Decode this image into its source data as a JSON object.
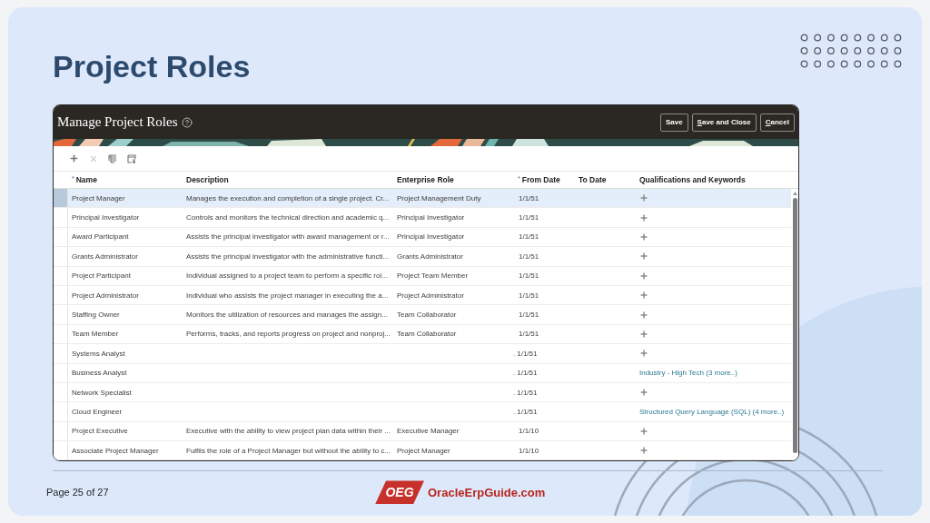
{
  "slide": {
    "title": "Project Roles"
  },
  "window": {
    "title": "Manage Project Roles",
    "buttons": [
      {
        "label": "Save",
        "mnemonic": false
      },
      {
        "label": "Save and Close",
        "mnemonic": true
      },
      {
        "label": "Cancel",
        "mnemonic": true
      }
    ]
  },
  "toolbar": [
    {
      "kind": "add",
      "disabled": false
    },
    {
      "kind": "delete",
      "disabled": true
    },
    {
      "kind": "freeze",
      "disabled": false
    },
    {
      "kind": "detach",
      "disabled": false
    }
  ],
  "table": {
    "columns": [
      {
        "label": "Name",
        "mark": "*"
      },
      {
        "label": "Description"
      },
      {
        "label": "Enterprise Role"
      },
      {
        "label": "From Date",
        "mark": "*"
      },
      {
        "label": "To Date"
      },
      {
        "label": "Qualifications and Keywords"
      }
    ],
    "rows": [
      {
        "name": "Project Manager",
        "description": "Manages the execution and completion of a single project. Cr...",
        "enterprise_role": "Project Management Duty",
        "from_date": "1/1/51",
        "qualifications": {
          "kind": "add"
        },
        "selected": true
      },
      {
        "name": "Principal Investigator",
        "description": "Controls and monitors the technical direction and academic q...",
        "enterprise_role": "Principal Investigator",
        "from_date": "1/1/51",
        "qualifications": {
          "kind": "add"
        },
        "selected": false
      },
      {
        "name": "Award Participant",
        "description": "Assists the principal investigator with award management or r...",
        "enterprise_role": "Principal Investigator",
        "from_date": "1/1/51",
        "qualifications": {
          "kind": "add"
        },
        "selected": false
      },
      {
        "name": "Grants Administrator",
        "description": "Assists the principal investigator with the administrative functi...",
        "enterprise_role": "Grants Administrator",
        "from_date": "1/1/51",
        "qualifications": {
          "kind": "add"
        },
        "selected": false
      },
      {
        "name": "Project Participant",
        "description": "Individual assigned to a project team to perform a specific rol...",
        "enterprise_role": "Project Team Member",
        "from_date": "1/1/51",
        "qualifications": {
          "kind": "add"
        },
        "selected": false
      },
      {
        "name": "Project Administrator",
        "description": "Individual who assists the project manager in executing the a...",
        "enterprise_role": "Project Administrator",
        "from_date": "1/1/51",
        "qualifications": {
          "kind": "add"
        },
        "selected": false
      },
      {
        "name": "Staffing Owner",
        "description": "Monitors the utilization of resources and manages the assign...",
        "enterprise_role": "Team Collaborator",
        "from_date": "1/1/51",
        "qualifications": {
          "kind": "add"
        },
        "selected": false
      },
      {
        "name": "Team Member",
        "description": "Performs, tracks, and reports progress on project and nonproj...",
        "enterprise_role": "Team Collaborator",
        "from_date": "1/1/51",
        "qualifications": {
          "kind": "add"
        },
        "selected": false
      },
      {
        "name": "Systems Analyst",
        "date_mark": ".",
        "from_date": "1/1/51",
        "qualifications": {
          "kind": "add"
        },
        "selected": false
      },
      {
        "name": "Business Analyst",
        "date_mark": ".",
        "from_date": "1/1/51",
        "qualifications": {
          "kind": "link",
          "text": "Industry - High Tech (3 more..)"
        },
        "selected": false
      },
      {
        "name": "Network Specialist",
        "date_mark": ".",
        "from_date": "1/1/51",
        "qualifications": {
          "kind": "add"
        },
        "selected": false
      },
      {
        "name": "Cloud Engineer",
        "date_mark": ".",
        "from_date": "1/1/51",
        "qualifications": {
          "kind": "link",
          "text": "Structured Query Language (SQL) (4 more..)"
        },
        "selected": false
      },
      {
        "name": "Project Executive",
        "description": "Executive with the ability to view project plan data within their ...",
        "enterprise_role": "Executive Manager",
        "from_date": "1/1/10",
        "qualifications": {
          "kind": "add"
        },
        "selected": false
      },
      {
        "name": "Associate Project Manager",
        "description": "Fulfils the role of a Project Manager but without the ability to c...",
        "enterprise_role": "Project Manager",
        "from_date": "1/1/10",
        "qualifications": {
          "kind": "add"
        },
        "selected": false
      }
    ]
  },
  "footer": {
    "page": "Page 25 of 27",
    "logo_mark": "OEG",
    "logo_text": "OracleErpGuide.com"
  }
}
